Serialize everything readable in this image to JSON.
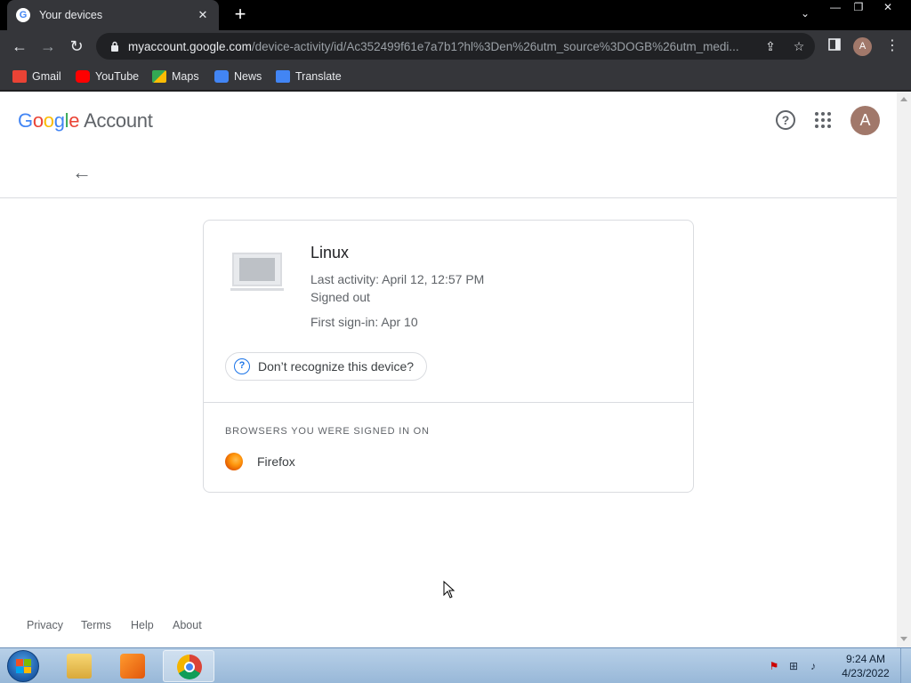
{
  "browser": {
    "tab_title": "Your devices",
    "tab_favicon": "G",
    "url_host": "myaccount.google.com",
    "url_path": "/device-activity/id/Ac352499f61e7a7b1?hl%3Den%26utm_source%3DOGB%26utm_medi...",
    "profile_initial": "A",
    "bookmarks": [
      {
        "label": "Gmail",
        "icon": "gmail-icon",
        "color": "#EA4335"
      },
      {
        "label": "YouTube",
        "icon": "youtube-icon",
        "color": "#FF0000"
      },
      {
        "label": "Maps",
        "icon": "maps-icon",
        "color": "#34A853"
      },
      {
        "label": "News",
        "icon": "news-icon",
        "color": "#4285F4"
      },
      {
        "label": "Translate",
        "icon": "translate-icon",
        "color": "#4285F4"
      }
    ]
  },
  "header": {
    "logo_google": "Google",
    "logo_account": "Account",
    "avatar_initial": "A"
  },
  "device": {
    "name": "Linux",
    "last_activity": "Last activity: April 12, 12:57 PM",
    "status": "Signed out",
    "first_sign_in": "First sign-in: Apr 10",
    "recognize_button": "Don’t recognize this device?",
    "browsers_heading": "BROWSERS YOU WERE SIGNED IN ON",
    "browsers": [
      {
        "name": "Firefox",
        "icon": "firefox-icon"
      }
    ]
  },
  "footer": {
    "links": [
      "Privacy",
      "Terms",
      "Help",
      "About"
    ]
  },
  "taskbar": {
    "time": "9:24 AM",
    "date": "4/23/2022",
    "apps": [
      "file-explorer-icon",
      "media-player-icon",
      "chrome-icon"
    ]
  },
  "colors": {
    "google_blue": "#4285F4",
    "google_red": "#EA4335",
    "google_yellow": "#FBBC05",
    "google_green": "#34A853",
    "avatar": "#a1786a",
    "link_blue": "#1a73e8"
  }
}
